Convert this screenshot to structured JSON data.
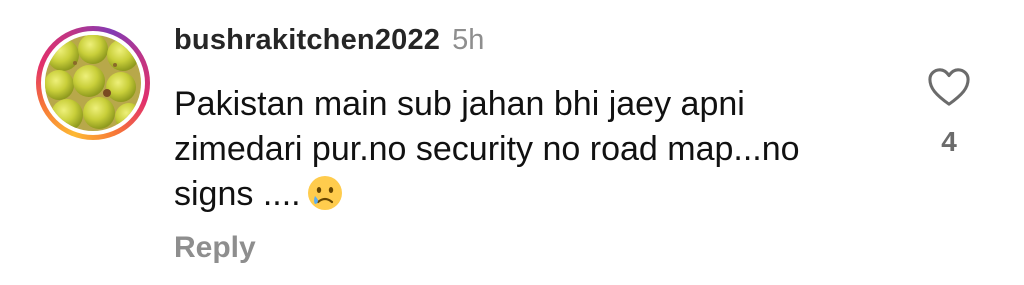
{
  "comment": {
    "username": "bushrakitchen2022",
    "time": "5h",
    "text": "Pakistan main sub jahan bhi jaey apni zimedari pur.no security no road map...no signs ....",
    "emoji": "crying-face",
    "reply_label": "Reply",
    "like_count": "4"
  },
  "colors": {
    "username": "#262626",
    "meta": "#8e8e8e",
    "story_ring": [
      "#fdb933",
      "#f77737",
      "#e1306c",
      "#c13584",
      "#833ab4"
    ]
  },
  "icons": {
    "like": "heart-outline-icon",
    "emoji": "crying-face-emoji"
  }
}
